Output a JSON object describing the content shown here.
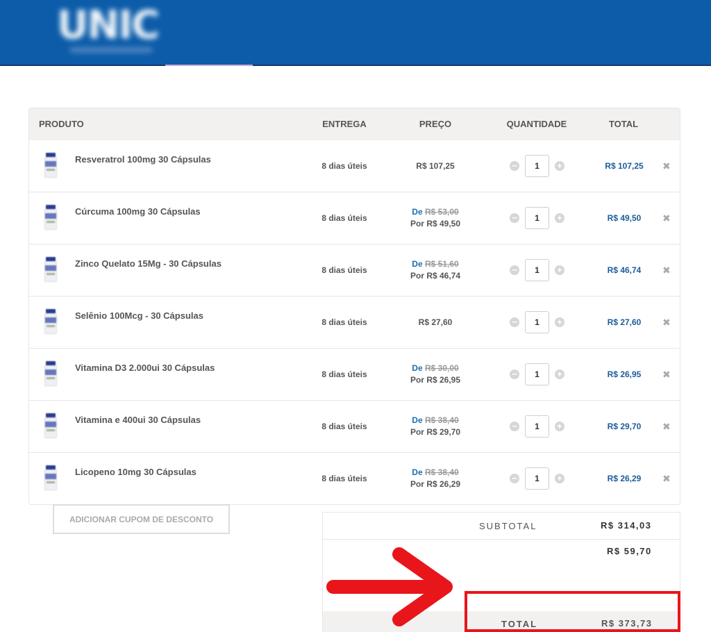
{
  "header": {
    "logo_text": "UNIC",
    "brand_color": "#0c5ca9"
  },
  "cart": {
    "columns": {
      "product": "PRODUTO",
      "delivery": "ENTREGA",
      "price": "PREÇO",
      "quantity": "QUANTIDADE",
      "total": "TOTAL"
    },
    "items": [
      {
        "name": "Resveratrol 100mg 30 Cápsulas",
        "delivery": "8 dias úteis",
        "price": "R$ 107,25",
        "de_label": "",
        "old_price": "",
        "por_label": "",
        "qty": "1",
        "total": "R$ 107,25"
      },
      {
        "name": "Cúrcuma 100mg 30 Cápsulas",
        "delivery": "8 dias úteis",
        "price": "R$ 49,50",
        "de_label": "De",
        "old_price": "R$ 53,00",
        "por_label": "Por",
        "qty": "1",
        "total": "R$ 49,50"
      },
      {
        "name": "Zinco Quelato 15Mg - 30 Cápsulas",
        "delivery": "8 dias úteis",
        "price": "R$ 46,74",
        "de_label": "De",
        "old_price": "R$ 51,60",
        "por_label": "Por",
        "qty": "1",
        "total": "R$ 46,74"
      },
      {
        "name": "Selênio 100Mcg - 30 Cápsulas",
        "delivery": "8 dias úteis",
        "price": "R$ 27,60",
        "de_label": "",
        "old_price": "",
        "por_label": "",
        "qty": "1",
        "total": "R$ 27,60"
      },
      {
        "name": "Vitamina D3 2.000ui 30 Cápsulas",
        "delivery": "8 dias úteis",
        "price": "R$ 26,95",
        "de_label": "De",
        "old_price": "R$ 30,00",
        "por_label": "Por",
        "qty": "1",
        "total": "R$ 26,95"
      },
      {
        "name": "Vitamina e 400ui 30 Cápsulas",
        "delivery": "8 dias úteis",
        "price": "R$ 29,70",
        "de_label": "De",
        "old_price": "R$ 38,40",
        "por_label": "Por",
        "qty": "1",
        "total": "R$ 29,70"
      },
      {
        "name": "Licopeno 10mg 30 Cápsulas",
        "delivery": "8 dias úteis",
        "price": "R$ 26,29",
        "de_label": "De",
        "old_price": "R$ 38,40",
        "por_label": "Por",
        "qty": "1",
        "total": "R$ 26,29"
      }
    ],
    "minus_symbol": "−",
    "plus_symbol": "+",
    "remove_symbol": "✖"
  },
  "coupon": {
    "label": "ADICIONAR CUPOM DE DESCONTO"
  },
  "summary": {
    "subtotal_label": "SUBTOTAL",
    "subtotal_value": "R$ 314,03",
    "shipping_value": "R$ 59,70",
    "total_label": "TOTAL",
    "total_value": "R$ 373,73"
  },
  "annotation": {
    "color": "#e8151b"
  }
}
